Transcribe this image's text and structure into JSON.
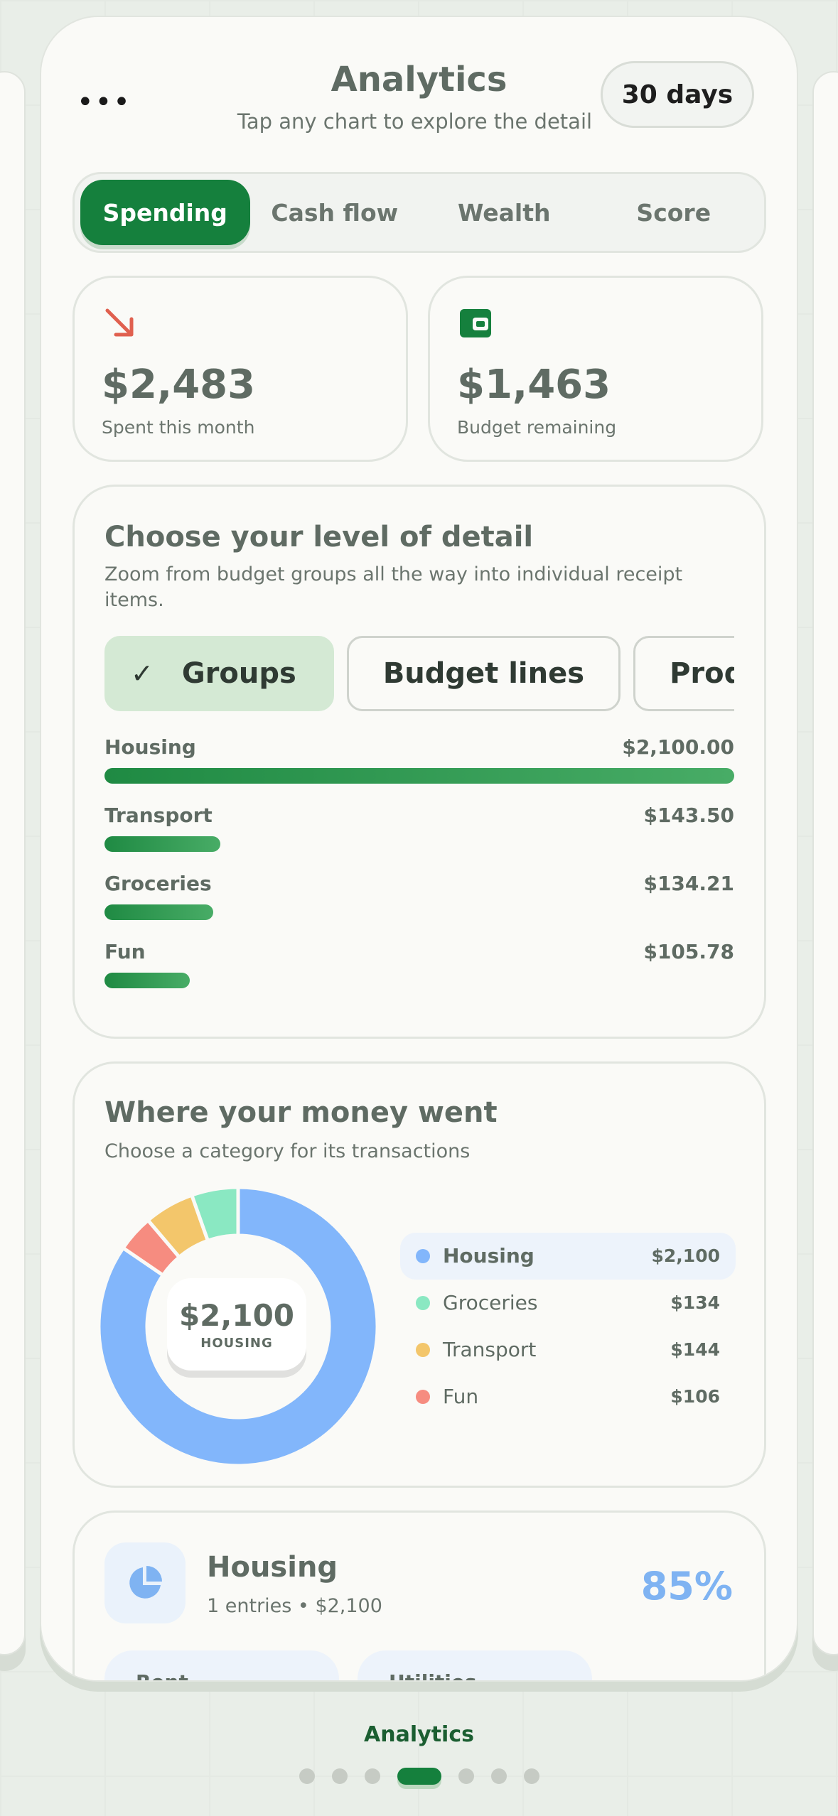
{
  "header": {
    "title": "Analytics",
    "subtitle": "Tap any chart to explore the detail",
    "period_label": "30 days",
    "menu_icon": "more-dots-icon"
  },
  "tabs": [
    {
      "label": "Spending",
      "active": true
    },
    {
      "label": "Cash flow",
      "active": false
    },
    {
      "label": "Wealth",
      "active": false
    },
    {
      "label": "Score",
      "active": false
    }
  ],
  "stats": [
    {
      "value": "$2,483",
      "label": "Spent this month",
      "icon": "arrow-down-right-icon",
      "icon_color": "#e0604f"
    },
    {
      "value": "$1,463",
      "label": "Budget remaining",
      "icon": "wallet-icon",
      "icon_color": "#15803d"
    }
  ],
  "detail": {
    "title": "Choose your level of detail",
    "subtitle": "Zoom from budget groups all the way into individual receipt items.",
    "levels": [
      {
        "label": "Groups",
        "selected": true
      },
      {
        "label": "Budget lines",
        "selected": false
      },
      {
        "label": "Produc",
        "selected": false
      }
    ],
    "rows": [
      {
        "name": "Housing",
        "amount": "$2,100.00",
        "value": 2100.0
      },
      {
        "name": "Transport",
        "amount": "$143.50",
        "value": 143.5
      },
      {
        "name": "Groceries",
        "amount": "$134.21",
        "value": 134.21
      },
      {
        "name": "Fun",
        "amount": "$105.78",
        "value": 105.78
      }
    ]
  },
  "money": {
    "title": "Where your money went",
    "subtitle": "Choose a category for its transactions",
    "center_value": "$2,100",
    "center_label": "HOUSING",
    "legend": [
      {
        "name": "Housing",
        "amount": "$2,100",
        "color": "#82b6fb",
        "active": true
      },
      {
        "name": "Groceries",
        "amount": "$134",
        "color": "#8ae8c2",
        "active": false
      },
      {
        "name": "Transport",
        "amount": "$144",
        "color": "#f3c66b",
        "active": false
      },
      {
        "name": "Fun",
        "amount": "$106",
        "color": "#f68c80",
        "active": false
      }
    ]
  },
  "chart_data": {
    "type": "pie",
    "categories": [
      "Housing",
      "Fun",
      "Transport",
      "Groceries"
    ],
    "values": [
      2100,
      106,
      144,
      134
    ],
    "colors": [
      "#82b6fb",
      "#f68c80",
      "#f3c66b",
      "#8ae8c2"
    ],
    "donut": true
  },
  "housing": {
    "icon": "pie-chart-icon",
    "title": "Housing",
    "subtitle": "1 entries • $2,100",
    "percent": "85%",
    "chips": [
      "Rent",
      "Utilities"
    ]
  },
  "footer": {
    "label": "Analytics",
    "pages": 7,
    "active_page": 3
  }
}
